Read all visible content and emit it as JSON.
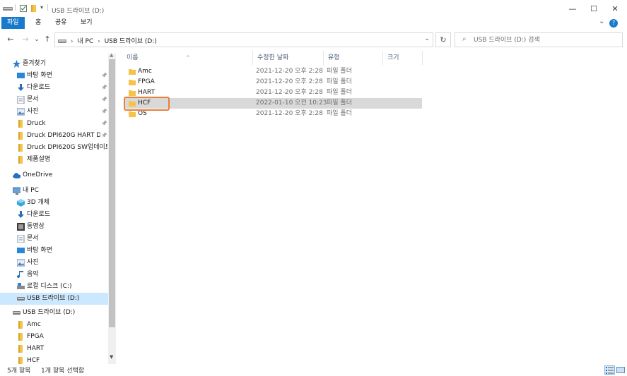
{
  "window": {
    "title": "USB 드라이브 (D:)",
    "minimize": "—",
    "maximize": "☐",
    "close": "✕"
  },
  "ribbon": {
    "tabs": [
      {
        "label": "파일",
        "active": true
      },
      {
        "label": "홈"
      },
      {
        "label": "공유"
      },
      {
        "label": "보기"
      }
    ],
    "help": "?",
    "expand": "⌄"
  },
  "nav_buttons": {
    "back": "←",
    "forward": "→",
    "recent": "⌄",
    "up": "↑"
  },
  "address": {
    "sep": "›",
    "crumbs": [
      "내 PC",
      "USB 드라이브 (D:)"
    ],
    "dropdown": "⌄",
    "refresh": "↻"
  },
  "search": {
    "placeholder": "USB 드라이브 (D:) 검색",
    "icon": "⌕"
  },
  "nav_pane": {
    "quick_access": "즐겨찾기",
    "quick_items": [
      {
        "label": "바탕 화면",
        "icon": "desktop-icon",
        "pinned": true
      },
      {
        "label": "다운로드",
        "icon": "download-icon",
        "pinned": true
      },
      {
        "label": "문서",
        "icon": "document-icon",
        "pinned": true
      },
      {
        "label": "사진",
        "icon": "pictures-icon",
        "pinned": true
      },
      {
        "label": "Druck",
        "icon": "folder-icon",
        "pinned": true
      },
      {
        "label": "Druck DPI620G HART DD F",
        "icon": "folder-icon",
        "pinned": true
      },
      {
        "label": "Druck DPI620G SW업데이트_",
        "icon": "folder-icon",
        "pinned": false
      },
      {
        "label": "제품설명",
        "icon": "folder-icon",
        "pinned": false
      }
    ],
    "onedrive": "OneDrive",
    "this_pc": "내 PC",
    "pc_items": [
      {
        "label": "3D 개체",
        "icon": "3d-objects-icon"
      },
      {
        "label": "다운로드",
        "icon": "download-icon"
      },
      {
        "label": "동영상",
        "icon": "videos-icon"
      },
      {
        "label": "문서",
        "icon": "document-icon"
      },
      {
        "label": "바탕 화면",
        "icon": "desktop-icon"
      },
      {
        "label": "사진",
        "icon": "pictures-icon"
      },
      {
        "label": "음악",
        "icon": "music-icon"
      },
      {
        "label": "로컬 디스크 (C:)",
        "icon": "local-disk-icon"
      },
      {
        "label": "USB 드라이브 (D:)",
        "icon": "usb-drive-icon",
        "selected": true
      }
    ],
    "usb_root": "USB 드라이브 (D:)",
    "usb_items": [
      {
        "label": "Amc"
      },
      {
        "label": "FPGA"
      },
      {
        "label": "HART"
      },
      {
        "label": "HCF"
      }
    ],
    "pin_glyph": "📌"
  },
  "columns": {
    "name": "이름",
    "date": "수정한 날짜",
    "type": "유형",
    "size": "크기",
    "sort_arrow": "^"
  },
  "files": [
    {
      "name": "Amc",
      "date": "2021-12-20 오후 2:28",
      "type": "파일 폴더"
    },
    {
      "name": "FPGA",
      "date": "2021-12-20 오후 2:28",
      "type": "파일 폴더"
    },
    {
      "name": "HART",
      "date": "2021-12-20 오후 2:28",
      "type": "파일 폴더"
    },
    {
      "name": "HCF",
      "date": "2022-01-10 오전 10:23",
      "type": "파일 폴더",
      "selected": true
    },
    {
      "name": "OS",
      "date": "2021-12-20 오후 2:28",
      "type": "파일 폴더"
    }
  ],
  "status": {
    "count": "5개 항목",
    "selection": "1개 항목 선택함"
  },
  "colors": {
    "accent": "#1979ca",
    "folder": "#f5c24a",
    "selection": "#cce8ff",
    "highlight": "#e8803a"
  }
}
